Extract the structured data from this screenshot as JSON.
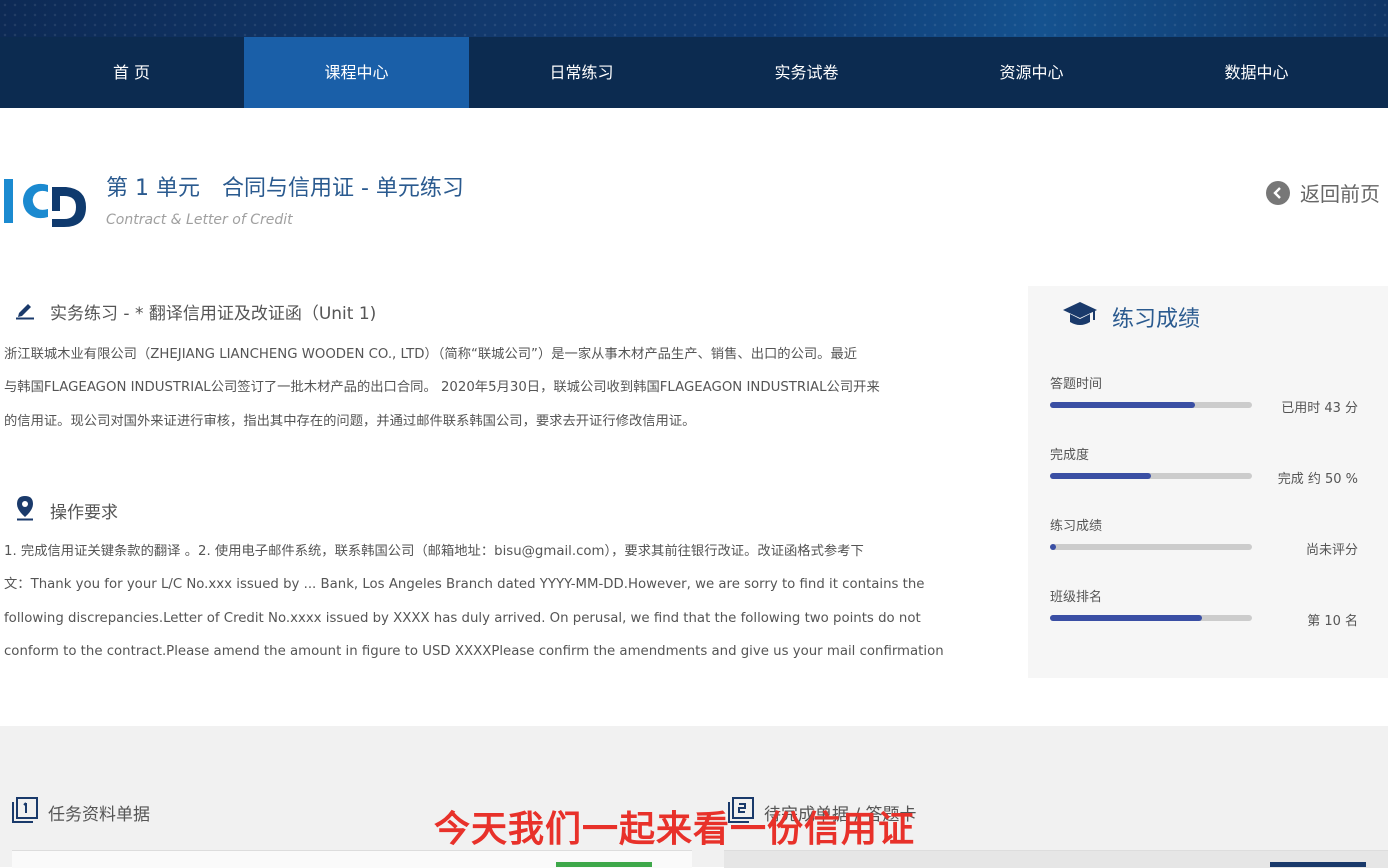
{
  "nav": {
    "items": [
      "首 页",
      "课程中心",
      "日常练习",
      "实务试卷",
      "资源中心",
      "数据中心"
    ],
    "active_index": 1
  },
  "header": {
    "title": "第 1 单元　合同与信用证 - 单元练习",
    "subtitle": "Contract & Letter of Credit",
    "back_label": "返回前页"
  },
  "exercise": {
    "title": "实务练习 - * 翻译信用证及改证函（Unit 1)",
    "description_lines": [
      "浙江联城木业有限公司（ZHEJIANG LIANCHENG WOODEN CO., LTD）（简称“联城公司”）是一家从事木材产品生产、销售、出口的公司。最近",
      "与韩国FLAGEAGON INDUSTRIAL公司签订了一批木材产品的出口合同。 2020年5月30日，联城公司收到韩国FLAGEAGON INDUSTRIAL公司开来",
      "的信用证。现公司对国外来证进行审核，指出其中存在的问题，并通过邮件联系韩国公司，要求去开证行修改信用证。"
    ]
  },
  "requirements": {
    "title": "操作要求",
    "lines": [
      "1. 完成信用证关键条款的翻译 。2. 使用电子邮件系统，联系韩国公司（邮箱地址：bisu@gmail.com），要求其前往银行改证。改证函格式参考下",
      "文：Thank you for your L/C No.xxx issued by ... Bank, Los Angeles Branch dated YYYY-MM-DD.However, we are sorry to find it contains the",
      "following discrepancies.Letter of Credit No.xxxx issued by XXXX has duly arrived. On perusal, we find that the following two points do not",
      "conform to the contract.Please amend the amount in figure to USD XXXXPlease confirm the amendments and give us your mail confirmation"
    ]
  },
  "score_panel": {
    "title": "练习成绩",
    "metrics": [
      {
        "name": "答题时间",
        "value": "已用时 43 分",
        "fraction": 0.72
      },
      {
        "name": "完成度",
        "value": "完成 约 50 %",
        "fraction": 0.5
      },
      {
        "name": "练习成绩",
        "value": "尚未评分",
        "fraction": 0.03
      },
      {
        "name": "班级排名",
        "value": "第 10 名",
        "fraction": 0.75
      }
    ]
  },
  "bottom": {
    "tab_left": "任务资料单据",
    "tab_right": "待完成单据 / 答题卡"
  },
  "caption": "今天我们一起来看一份信用证",
  "colors": {
    "nav_bg": "#0c2b50",
    "nav_active": "#1a5fa8",
    "accent_blue": "#2a5a8f",
    "bar_fill": "#3a4fa4",
    "caption_red": "#e8312a"
  }
}
